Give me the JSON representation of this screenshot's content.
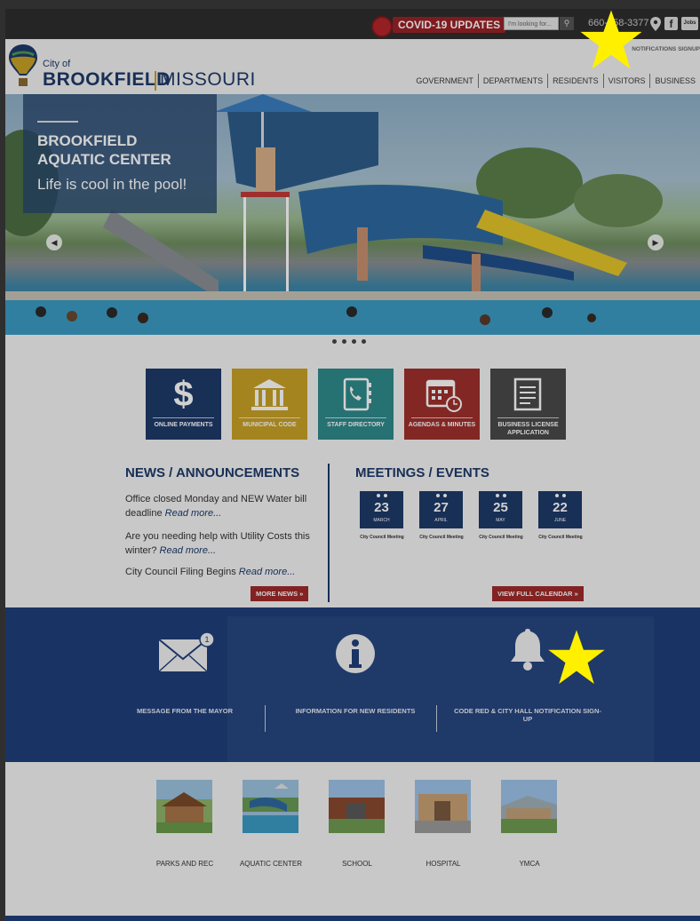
{
  "topbar": {
    "covid_label": "COVID-19 UPDATES",
    "search_placeholder": "I'm looking for...",
    "phone": "660-258-3377",
    "jobs_label": "Jobs",
    "notifications_signup": "NOTIFICATIONS SIGNUP"
  },
  "header": {
    "city_of": "City of",
    "brand_bold": "BROOKFIELD",
    "brand_light": "MISSOURI",
    "nav": [
      "GOVERNMENT",
      "DEPARTMENTS",
      "RESIDENTS",
      "VISITORS",
      "BUSINESS"
    ]
  },
  "hero": {
    "title": "BROOKFIELD AQUATIC CENTER",
    "subtitle": "Life is cool in the pool!",
    "slide_count": 4
  },
  "tiles": [
    {
      "label": "ONLINE PAYMENTS",
      "icon": "dollar-icon",
      "color": "#1e3a6a"
    },
    {
      "label": "MUNICIPAL CODE",
      "icon": "courthouse-icon",
      "color": "#c9a227"
    },
    {
      "label": "STAFF DIRECTORY",
      "icon": "phone-book-icon",
      "color": "#2f8a8c"
    },
    {
      "label": "AGENDAS & MINUTES",
      "icon": "calendar-clock-icon",
      "color": "#a0302c"
    },
    {
      "label": "BUSINESS LICENSE APPLICATION",
      "icon": "document-icon",
      "color": "#4a4a4a"
    }
  ],
  "news": {
    "title": "NEWS / ANNOUNCEMENTS",
    "items": [
      {
        "text": "Office closed Monday and NEW Water bill deadline ",
        "link": "Read more..."
      },
      {
        "text": "Are you needing help with Utility Costs this winter? ",
        "link": "Read more..."
      },
      {
        "text": "City Council Filing Begins ",
        "link": "Read more..."
      }
    ],
    "more_button": "MORE NEWS »"
  },
  "meetings": {
    "title": "MEETINGS / EVENTS",
    "events": [
      {
        "day": "23",
        "month": "MARCH",
        "label": "City Council Meeting"
      },
      {
        "day": "27",
        "month": "APRIL",
        "label": "City Council Meeting"
      },
      {
        "day": "25",
        "month": "MAY",
        "label": "City Council Meeting"
      },
      {
        "day": "22",
        "month": "JUNE",
        "label": "City Council Meeting"
      }
    ],
    "calendar_button": "VIEW FULL CALENDAR »"
  },
  "band": {
    "items": [
      {
        "label": "MESSAGE FROM THE MAYOR",
        "icon": "envelope-icon",
        "badge": "1"
      },
      {
        "label": "INFORMATION FOR NEW RESIDENTS",
        "icon": "info-icon"
      },
      {
        "label": "CODE RED & CITY HALL NOTIFICATION SIGN-UP",
        "icon": "bell-icon"
      }
    ]
  },
  "quicklinks": [
    {
      "label": "PARKS AND REC"
    },
    {
      "label": "AQUATIC CENTER"
    },
    {
      "label": "SCHOOL"
    },
    {
      "label": "HOSPITAL"
    },
    {
      "label": "YMCA"
    }
  ],
  "colors": {
    "brand_blue": "#1e3a6a",
    "accent_red": "#a02a2a",
    "star": "#fff000"
  }
}
